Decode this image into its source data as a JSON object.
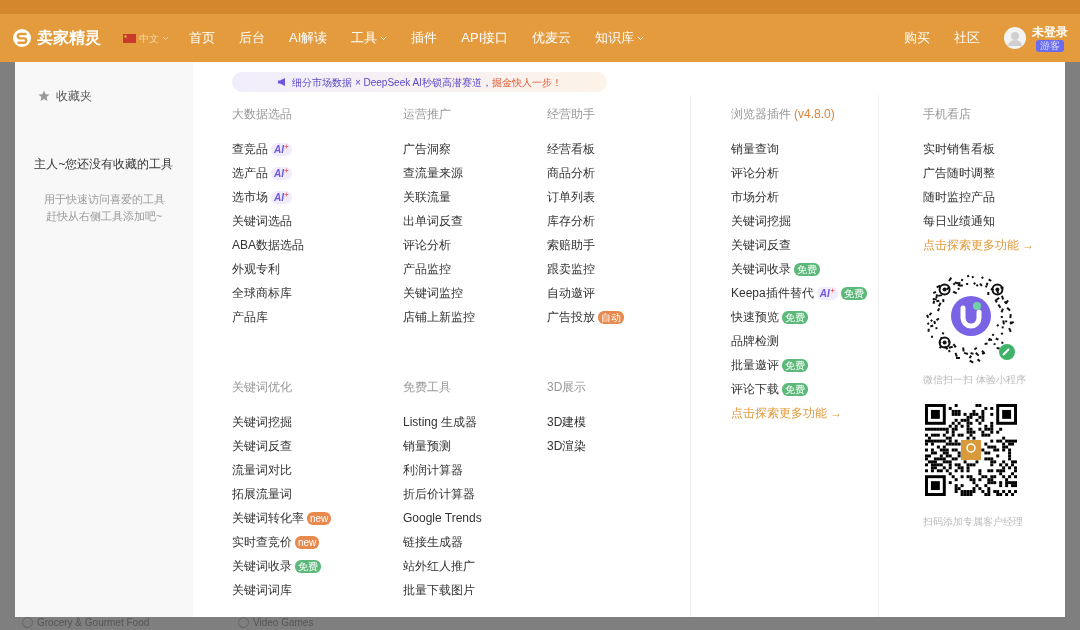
{
  "nav": {
    "brand": "卖家精灵",
    "language": {
      "label": "中文",
      "dropdown": true
    },
    "items": [
      {
        "label": "首页",
        "dropdown": false
      },
      {
        "label": "后台",
        "dropdown": false
      },
      {
        "label": "AI解读",
        "dropdown": false
      },
      {
        "label": "工具",
        "dropdown": true
      },
      {
        "label": "插件",
        "dropdown": false
      },
      {
        "label": "API接口",
        "dropdown": false
      },
      {
        "label": "优麦云",
        "dropdown": false
      },
      {
        "label": "知识库",
        "dropdown": true
      }
    ],
    "right_items": [
      "购买",
      "社区"
    ],
    "user": {
      "name": "未登录",
      "badge": "游客"
    }
  },
  "favorites": {
    "title": "收藏夹",
    "empty_title": "主人~您还没有收藏的工具",
    "empty_hint": [
      "用于快速访问喜爱的工具",
      "赶快从右侧工具添加吧~"
    ]
  },
  "banner": {
    "lead": "细分市场数据 × DeepSeek AI秒锁高潜赛道，",
    "tail": "掘金快人一步！"
  },
  "sections": [
    {
      "title": "大数据选品",
      "items": [
        {
          "label": "查竞品",
          "badges": [
            {
              "kind": "ai",
              "text": "AI"
            }
          ]
        },
        {
          "label": "选产品",
          "badges": [
            {
              "kind": "ai",
              "text": "AI"
            }
          ]
        },
        {
          "label": "选市场",
          "badges": [
            {
              "kind": "ai",
              "text": "AI"
            }
          ]
        },
        {
          "label": "关键词选品"
        },
        {
          "label": "ABA数据选品"
        },
        {
          "label": "外观专利"
        },
        {
          "label": "全球商标库"
        },
        {
          "label": "产品库"
        }
      ]
    },
    {
      "title": "运营推广",
      "items": [
        {
          "label": "广告洞察"
        },
        {
          "label": "查流量来源"
        },
        {
          "label": "关联流量"
        },
        {
          "label": "出单词反查"
        },
        {
          "label": "评论分析"
        },
        {
          "label": "产品监控"
        },
        {
          "label": "关键词监控"
        },
        {
          "label": "店铺上新监控"
        }
      ]
    },
    {
      "title": "经营助手",
      "items": [
        {
          "label": "经营看板"
        },
        {
          "label": "商品分析"
        },
        {
          "label": "订单列表"
        },
        {
          "label": "库存分析"
        },
        {
          "label": "索赔助手"
        },
        {
          "label": "跟卖监控"
        },
        {
          "label": "自动邀评"
        },
        {
          "label": "广告投放",
          "badges": [
            {
              "kind": "auto",
              "text": "自动"
            }
          ]
        }
      ]
    },
    {
      "title": "关键词优化",
      "items": [
        {
          "label": "关键词挖掘"
        },
        {
          "label": "关键词反查"
        },
        {
          "label": "流量词对比"
        },
        {
          "label": "拓展流量词"
        },
        {
          "label": "关键词转化率",
          "badges": [
            {
              "kind": "new",
              "text": "new"
            }
          ]
        },
        {
          "label": "实时查竞价",
          "badges": [
            {
              "kind": "new",
              "text": "new"
            }
          ]
        },
        {
          "label": "关键词收录",
          "badges": [
            {
              "kind": "free",
              "text": "免费"
            }
          ]
        },
        {
          "label": "关键词词库"
        }
      ]
    },
    {
      "title": "免费工具",
      "items": [
        {
          "label": "Listing 生成器"
        },
        {
          "label": "销量预测"
        },
        {
          "label": "利润计算器"
        },
        {
          "label": "折后价计算器"
        },
        {
          "label": "Google Trends"
        },
        {
          "label": "链接生成器"
        },
        {
          "label": "站外红人推广"
        },
        {
          "label": "批量下载图片"
        }
      ]
    },
    {
      "title": "3D展示",
      "items": [
        {
          "label": "3D建模"
        },
        {
          "label": "3D渲染"
        }
      ]
    }
  ],
  "plugin": {
    "title": "浏览器插件",
    "version": "(v4.8.0)",
    "items": [
      {
        "label": "销量查询"
      },
      {
        "label": "评论分析"
      },
      {
        "label": "市场分析"
      },
      {
        "label": "关键词挖掘"
      },
      {
        "label": "关键词反查"
      },
      {
        "label": "关键词收录",
        "badges": [
          {
            "kind": "free",
            "text": "免费"
          }
        ]
      },
      {
        "label": "Keepa插件替代",
        "badges": [
          {
            "kind": "ai",
            "text": "AI"
          },
          {
            "kind": "free",
            "text": "免费"
          }
        ]
      },
      {
        "label": "快速预览",
        "badges": [
          {
            "kind": "free",
            "text": "免费"
          }
        ]
      },
      {
        "label": "品牌检测"
      },
      {
        "label": "批量邀评",
        "badges": [
          {
            "kind": "free",
            "text": "免费"
          }
        ]
      },
      {
        "label": "评论下载",
        "badges": [
          {
            "kind": "free",
            "text": "免费"
          }
        ]
      }
    ],
    "more_link": "点击探索更多功能 →"
  },
  "mobile": {
    "title": "手机看店",
    "items": [
      {
        "label": "实时销售看板"
      },
      {
        "label": "广告随时调整"
      },
      {
        "label": "随时监控产品"
      },
      {
        "label": "每日业绩通知"
      }
    ],
    "more_link": "点击探索更多功能 →",
    "mini_program_caption": "微信扫一扫 体验小程序",
    "qr_caption": "扫码添加专属客户经理"
  },
  "background_page": {
    "checkboxes": [
      {
        "label": "Grocery & Gourmet Food",
        "checked": false
      },
      {
        "label": "Video Games",
        "checked": false
      }
    ]
  }
}
